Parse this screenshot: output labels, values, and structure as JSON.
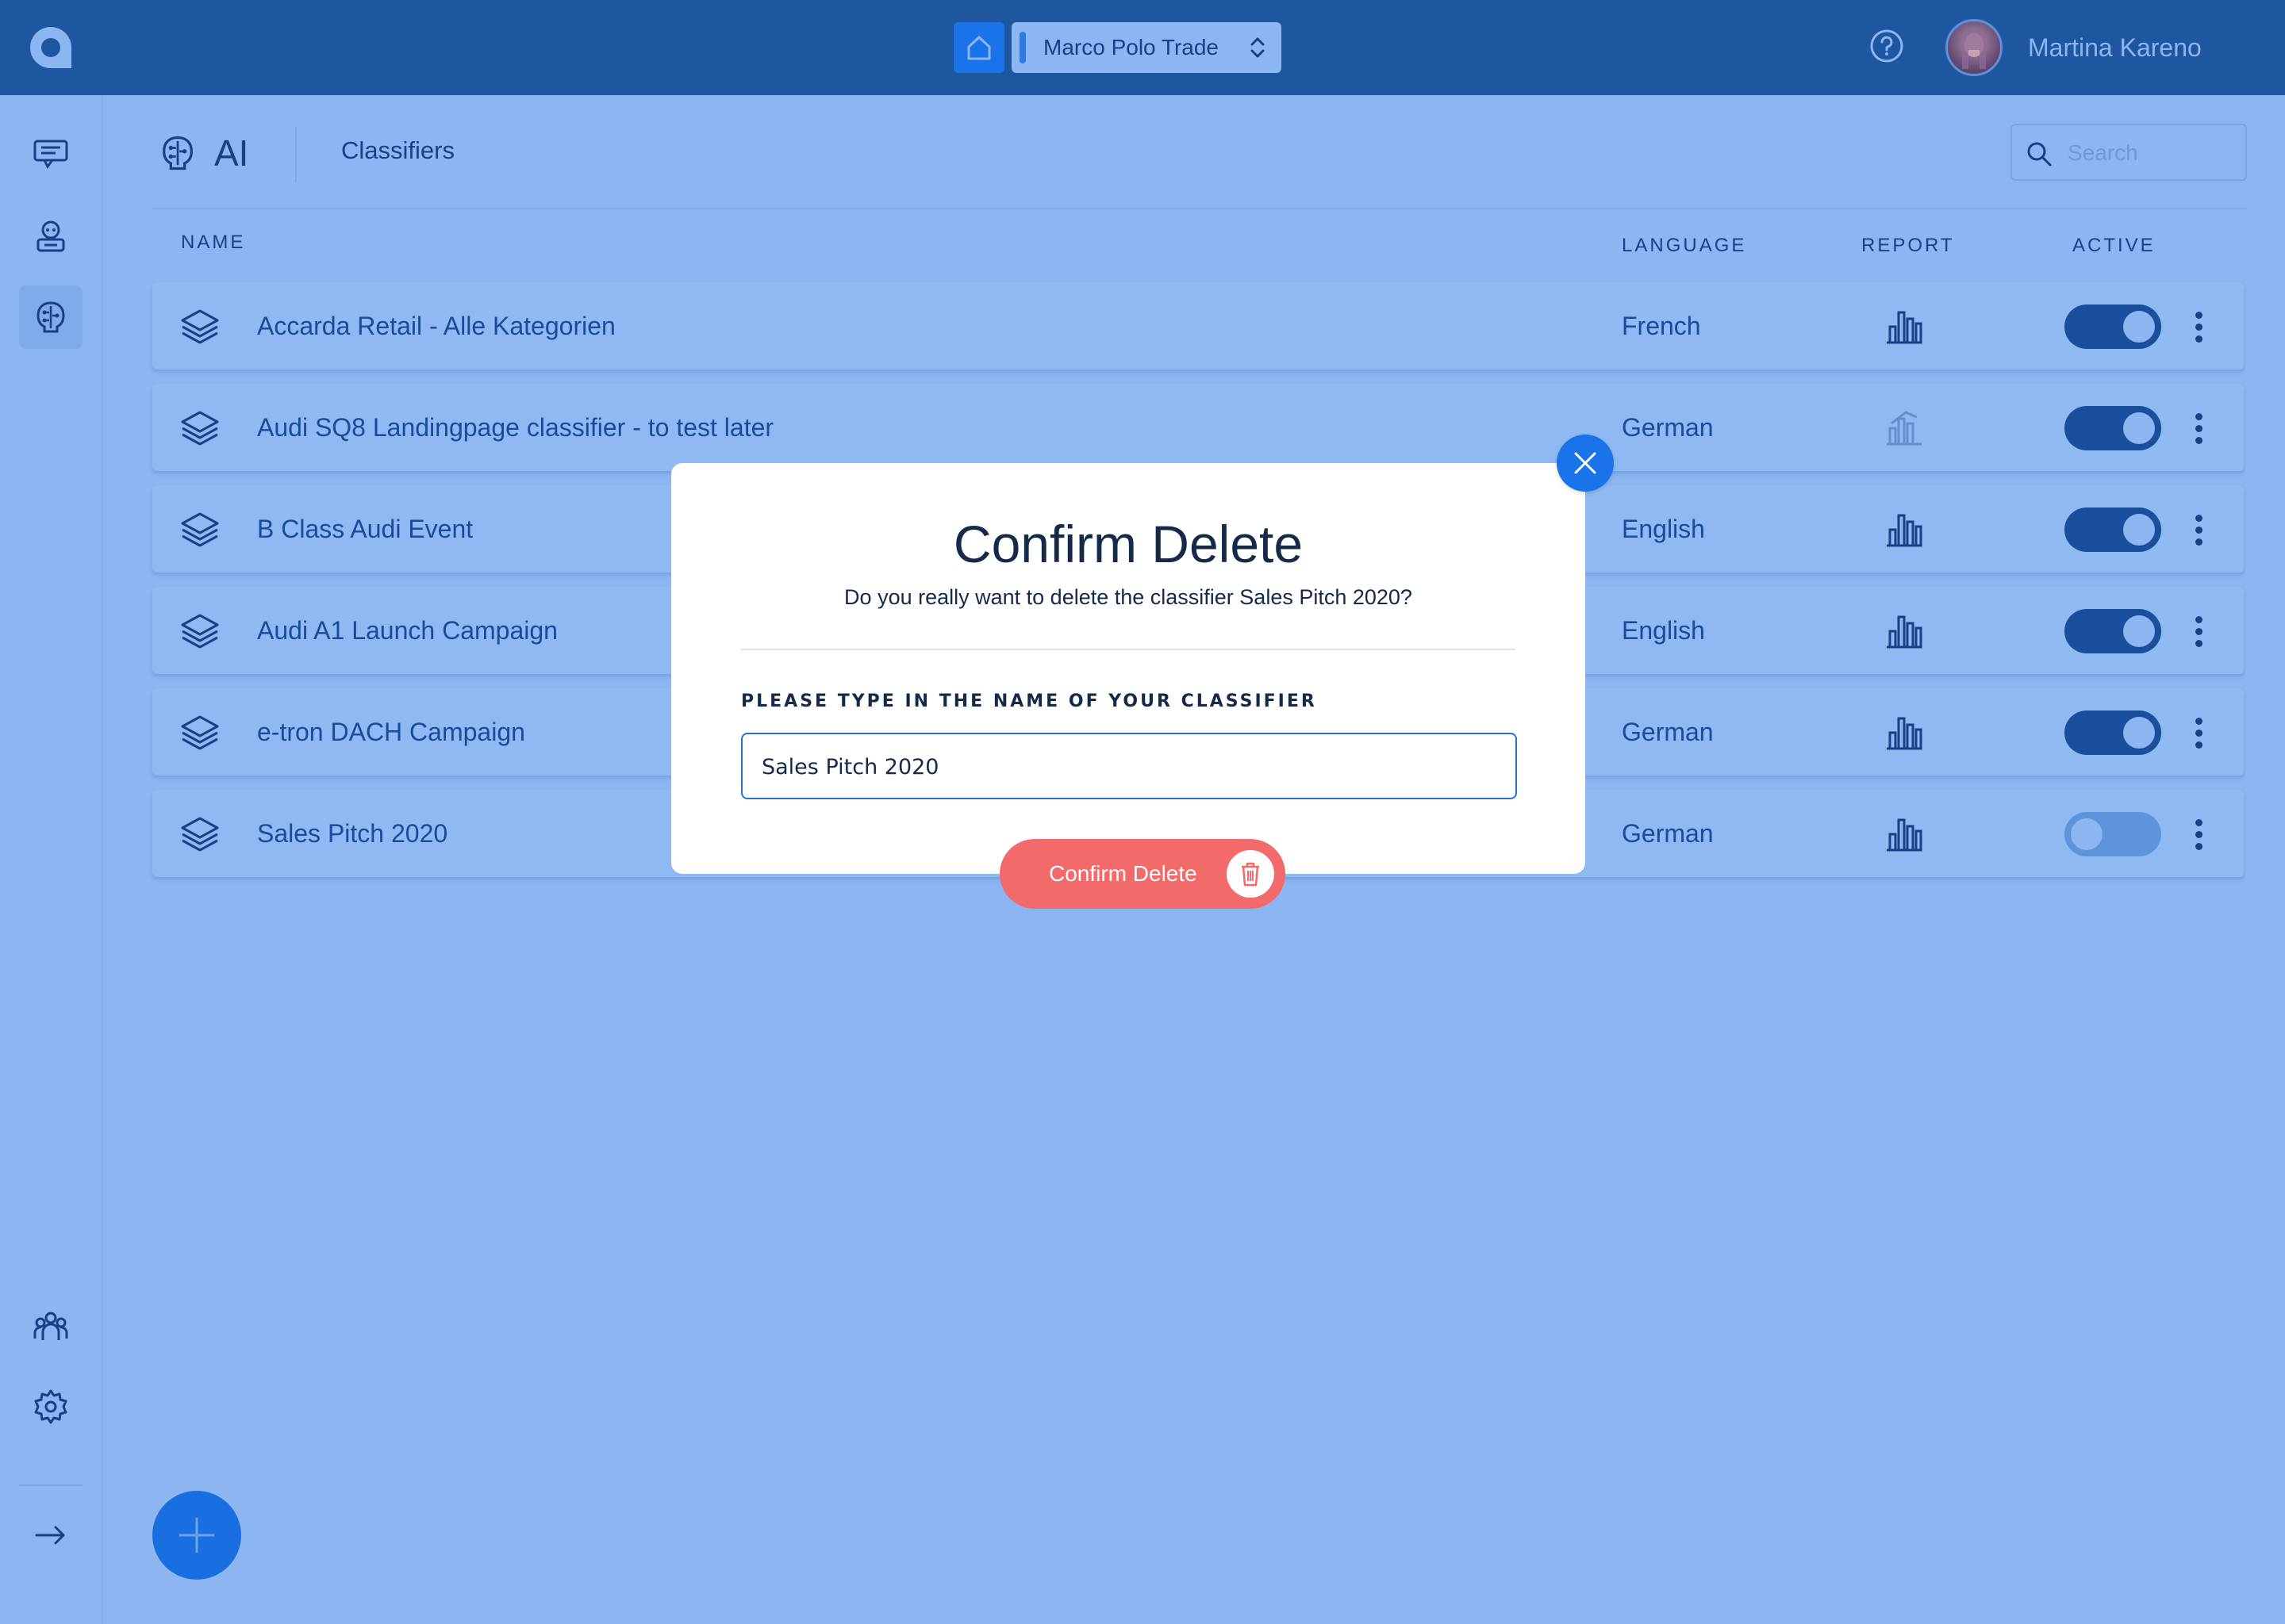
{
  "topbar": {
    "org_name": "Marco Polo Trade",
    "user_name": "Martina Kareno"
  },
  "header": {
    "section_title": "AI",
    "breadcrumb": "Classifiers",
    "search_placeholder": "Search"
  },
  "table": {
    "columns": {
      "name": "NAME",
      "language": "LANGUAGE",
      "report": "REPORT",
      "active": "ACTIVE"
    },
    "rows": [
      {
        "name": "Accarda Retail - Alle Kategorien",
        "language": "French",
        "report_available": true,
        "active": true
      },
      {
        "name": "Audi SQ8 Landingpage classifier - to test later",
        "language": "German",
        "report_available": false,
        "active": true
      },
      {
        "name": "B Class Audi Event",
        "language": "English",
        "report_available": true,
        "active": true
      },
      {
        "name": "Audi A1 Launch Campaign",
        "language": "English",
        "report_available": true,
        "active": true
      },
      {
        "name": "e-tron DACH Campaign",
        "language": "German",
        "report_available": true,
        "active": true
      },
      {
        "name": "Sales Pitch 2020",
        "language": "German",
        "report_available": true,
        "active": false
      }
    ]
  },
  "modal": {
    "title": "Confirm Delete",
    "description": "Do you really want to delete the classifier Sales Pitch 2020?",
    "field_label": "PLEASE TYPE IN THE NAME OF YOUR CLASSIFIER",
    "field_value": "Sales Pitch 2020",
    "confirm_label": "Confirm Delete"
  },
  "icons": {
    "logo": "logo-icon",
    "home": "home-icon",
    "help": "help-icon",
    "sidebar": [
      "conversations-icon",
      "bot-icon",
      "ai-brain-icon",
      "team-icon",
      "settings-icon",
      "expand-arrow-icon"
    ],
    "row": "layers-icon",
    "report": "bar-chart-icon",
    "close": "close-icon",
    "trash": "trash-icon",
    "add": "plus-icon"
  },
  "colors": {
    "topbar": "#1f56a0",
    "background": "#8bb6f1",
    "primary": "#1a73e8",
    "danger": "#f36a6a"
  }
}
